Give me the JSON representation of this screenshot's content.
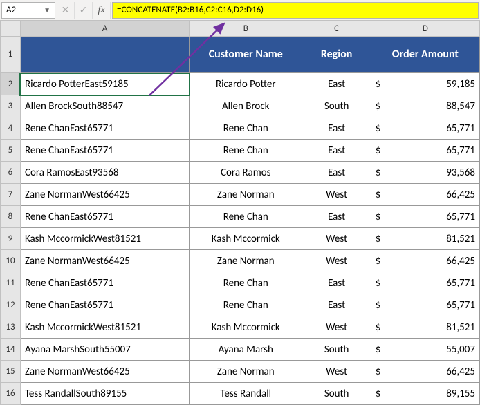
{
  "namebox": "A2",
  "formula": "=CONCATENATE(B2:B16,C2:C16,D2:D16)",
  "fx_label": "fx",
  "col_headers": [
    "A",
    "B",
    "C",
    "D"
  ],
  "headers": {
    "a": "",
    "b": "Customer Name",
    "c": "Region",
    "d": "Order Amount"
  },
  "rows": [
    {
      "n": "2",
      "a": "Ricardo PotterEast59185",
      "b": "Ricardo Potter",
      "c": "East",
      "d": "59,185"
    },
    {
      "n": "3",
      "a": "Allen BrockSouth88547",
      "b": "Allen Brock",
      "c": "South",
      "d": "88,547"
    },
    {
      "n": "4",
      "a": "Rene ChanEast65771",
      "b": "Rene Chan",
      "c": "East",
      "d": "65,771"
    },
    {
      "n": "5",
      "a": "Rene ChanEast65771",
      "b": "Rene Chan",
      "c": "East",
      "d": "65,771"
    },
    {
      "n": "6",
      "a": "Cora RamosEast93568",
      "b": "Cora Ramos",
      "c": "East",
      "d": "93,568"
    },
    {
      "n": "7",
      "a": "Zane NormanWest66425",
      "b": "Zane Norman",
      "c": "West",
      "d": "66,425"
    },
    {
      "n": "8",
      "a": "Rene ChanEast65771",
      "b": "Rene Chan",
      "c": "East",
      "d": "65,771"
    },
    {
      "n": "9",
      "a": "Kash MccormickWest81521",
      "b": "Kash Mccormick",
      "c": "West",
      "d": "81,521"
    },
    {
      "n": "10",
      "a": "Zane NormanWest66425",
      "b": "Zane Norman",
      "c": "West",
      "d": "66,425"
    },
    {
      "n": "11",
      "a": "Rene ChanEast65771",
      "b": "Rene Chan",
      "c": "East",
      "d": "65,771"
    },
    {
      "n": "12",
      "a": "Rene ChanEast65771",
      "b": "Rene Chan",
      "c": "East",
      "d": "65,771"
    },
    {
      "n": "13",
      "a": "Kash MccormickWest81521",
      "b": "Kash Mccormick",
      "c": "West",
      "d": "81,521"
    },
    {
      "n": "14",
      "a": "Ayana MarshSouth55007",
      "b": "Ayana Marsh",
      "c": "South",
      "d": "55,007"
    },
    {
      "n": "15",
      "a": "Zane NormanWest66425",
      "b": "Zane Norman",
      "c": "West",
      "d": "66,425"
    },
    {
      "n": "16",
      "a": "Tess RandallSouth89155",
      "b": "Tess Randall",
      "c": "South",
      "d": "89,155"
    }
  ]
}
